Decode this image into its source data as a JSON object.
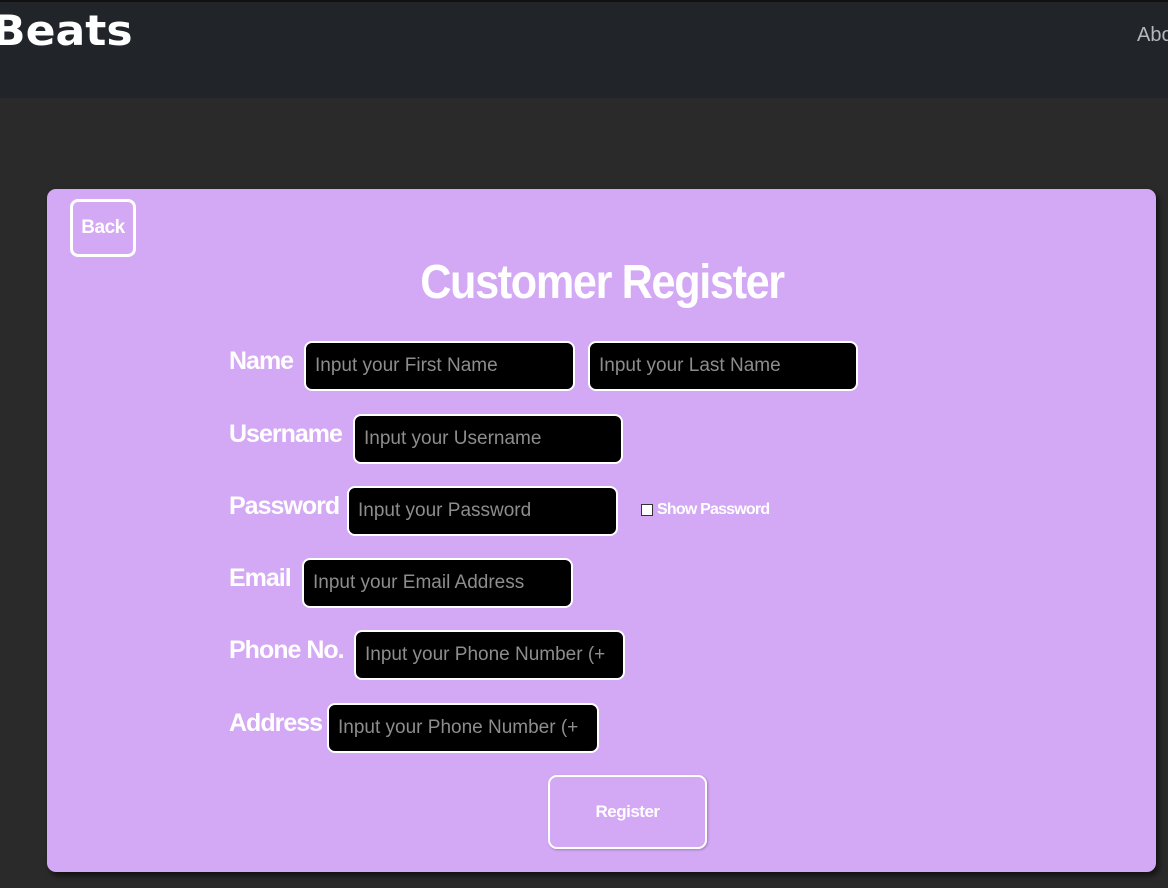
{
  "header": {
    "brand": "Beats",
    "nav_about": "Abo"
  },
  "form": {
    "back_label": "Back",
    "title": "Customer Register",
    "labels": {
      "name": "Name",
      "username": "Username",
      "password": "Password",
      "email": "Email",
      "phone": "Phone No.",
      "address": "Address"
    },
    "placeholders": {
      "first_name": "Input your First Name",
      "last_name": "Input your Last Name",
      "username": "Input your Username",
      "password": "Input your Password",
      "email": "Input your Email Address",
      "phone": "Input your Phone Number (+",
      "address": "Input your Phone Number (+"
    },
    "show_password_label": "Show Password",
    "register_label": "Register"
  },
  "colors": {
    "page_bg": "#2a2a2a",
    "header_bg": "#212428",
    "card_bg": "#d3a8f4",
    "field_bg": "#000000",
    "text": "#ffffff"
  }
}
